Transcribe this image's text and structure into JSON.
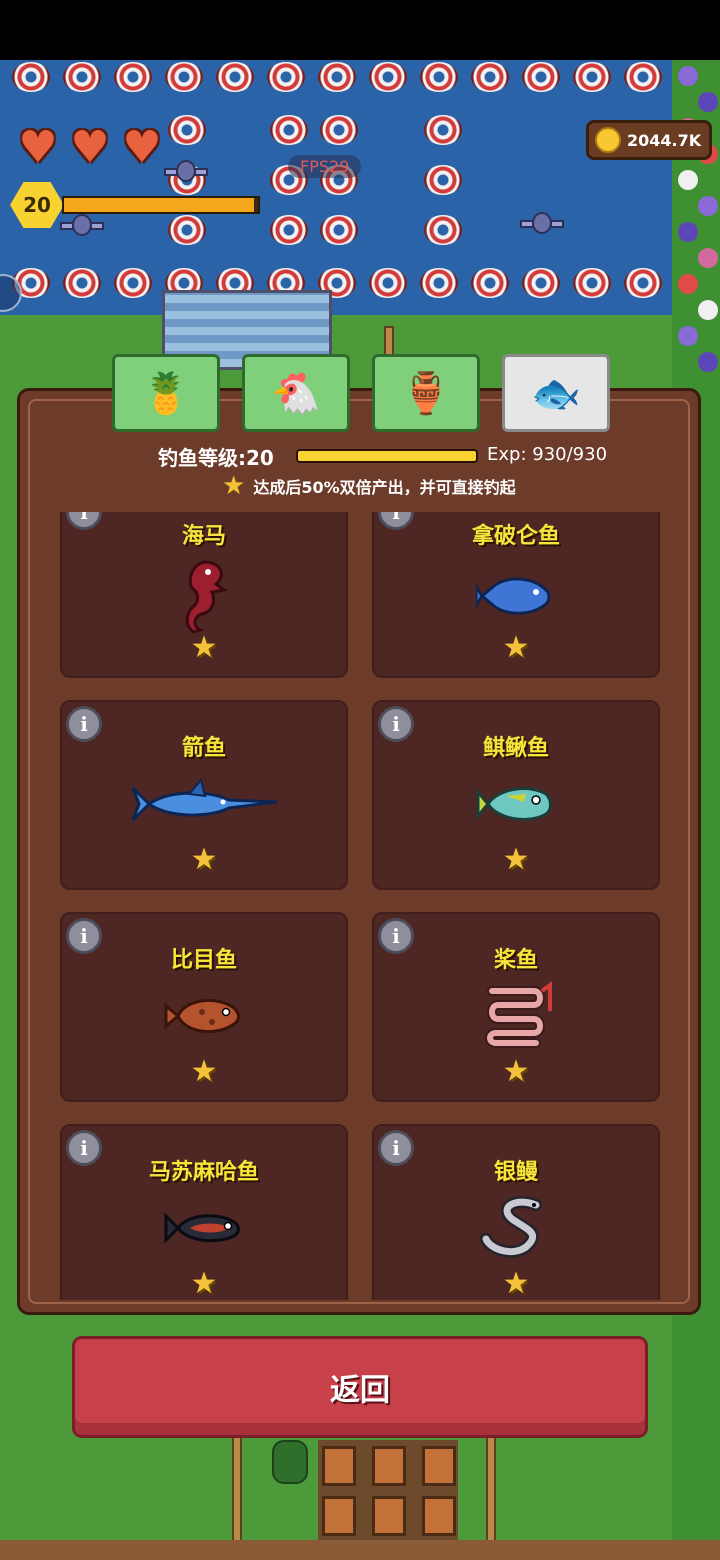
{
  "hud": {
    "player_level": "20",
    "hearts": [
      "♥",
      "♥",
      "♥"
    ],
    "xp_fraction": 0.98,
    "fps": "FPS29",
    "coins": "2044.7K"
  },
  "tabs": [
    {
      "icon": "pineapple-icon",
      "glyph": "🍍",
      "active": false
    },
    {
      "icon": "chicken-icon",
      "glyph": "🐔",
      "active": false
    },
    {
      "icon": "jar-icon",
      "glyph": "🏺",
      "active": false
    },
    {
      "icon": "fish-icon",
      "glyph": "🐟",
      "active": true
    }
  ],
  "fishing": {
    "level_label": "钓鱼等级:20",
    "level_fraction": 1.0,
    "exp": "Exp: 930/930",
    "bonus_text": "达成后50%双倍产出，并可直接钓起",
    "bonus_star": "★"
  },
  "fish_cards": [
    {
      "name": "海马",
      "icon": "seahorse-icon",
      "color": "#9b1f2e",
      "star": "★",
      "info": "i"
    },
    {
      "name": "拿破仑鱼",
      "icon": "napoleon-fish-icon",
      "color": "#3f76d6",
      "star": "★",
      "info": "i"
    },
    {
      "name": "箭鱼",
      "icon": "swordfish-icon",
      "color": "#4a8ee0",
      "star": "★",
      "info": "i"
    },
    {
      "name": "鲯鳅鱼",
      "icon": "mahi-mahi-icon",
      "color": "#6ec7c0",
      "star": "★",
      "info": "i"
    },
    {
      "name": "比目鱼",
      "icon": "flounder-icon",
      "color": "#b3542f",
      "star": "★",
      "info": "i"
    },
    {
      "name": "桨鱼",
      "icon": "oarfish-icon",
      "color": "#e8a6a6",
      "star": "★",
      "info": "i"
    },
    {
      "name": "马苏麻哈鱼",
      "icon": "masu-salmon-icon",
      "color": "#c2402e",
      "star": "★",
      "info": "i"
    },
    {
      "name": "银鳗",
      "icon": "silver-eel-icon",
      "color": "#c9c9d2",
      "star": "★",
      "info": "i"
    }
  ],
  "return_button": "返回",
  "colors": {
    "water": "#2a63a8",
    "grass": "#4c9a3a",
    "panel": "#6d3b2a",
    "card": "#4e2623",
    "fish_name": "#f8e53a",
    "return": "#c8404a"
  }
}
